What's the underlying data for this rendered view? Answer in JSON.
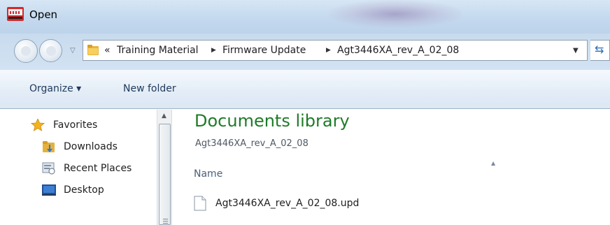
{
  "window": {
    "title": "Open"
  },
  "colors": {
    "library_title": "#1e7b28",
    "titlebar": "#c4d9ee",
    "toolbar_text": "#1e395b"
  },
  "address_bar": {
    "overflow": "«",
    "crumbs": [
      "Training Material",
      "Firmware Update",
      "Agt3446XA_rev_A_02_08"
    ]
  },
  "toolbar": {
    "organize_label": "Organize ▾",
    "new_folder_label": "New folder"
  },
  "nav": {
    "items": [
      {
        "label": "Favorites",
        "icon": "star-icon"
      },
      {
        "label": "Downloads",
        "icon": "downloads-folder-icon"
      },
      {
        "label": "Recent Places",
        "icon": "recent-places-icon"
      },
      {
        "label": "Desktop",
        "icon": "desktop-icon"
      }
    ]
  },
  "content": {
    "title": "Documents library",
    "subtitle": "Agt3446XA_rev_A_02_08",
    "column_header": "Name",
    "files": [
      {
        "name": "Agt3446XA_rev_A_02_08.upd",
        "icon": "file-icon"
      }
    ]
  }
}
